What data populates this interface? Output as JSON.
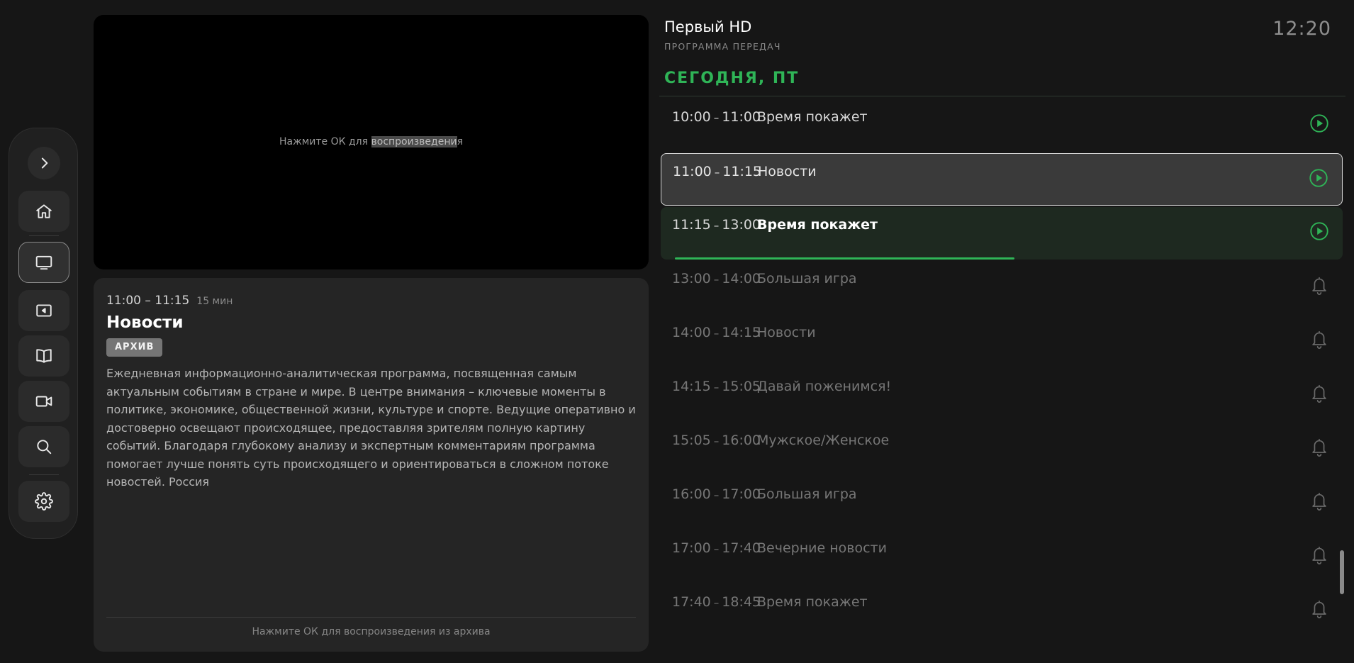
{
  "sidebar": {
    "items": [
      {
        "name": "expand",
        "icon": "chevron-right-icon"
      },
      {
        "name": "home",
        "icon": "home-icon"
      },
      {
        "name": "tv",
        "icon": "tv-icon",
        "active": true
      },
      {
        "name": "archive",
        "icon": "video-player-icon"
      },
      {
        "name": "library",
        "icon": "book-icon"
      },
      {
        "name": "camera",
        "icon": "video-camera-icon"
      },
      {
        "name": "search",
        "icon": "search-icon"
      },
      {
        "name": "settings",
        "icon": "gear-icon"
      }
    ]
  },
  "player": {
    "hint_prefix": "Нажмите ОК для ",
    "hint_highlight": "воспроизведени",
    "hint_suffix": "я"
  },
  "info": {
    "time": "11:00 – 11:15",
    "duration": "15 мин",
    "title": "Новости",
    "badge": "АРХИВ",
    "description": "Ежедневная информационно-аналитическая программа, посвященная самым актуальным событиям в стране и мире. В центре внимания – ключевые моменты в политике, экономике, общественной жизни, культуре и спорте. Ведущие оперативно и достоверно освещают происходящее, предоставляя зрителям полную картину событий. Благодаря глубокому анализу и экспертным комментариям программа помогает лучше понять суть происходящего и ориентироваться в сложном потоке новостей. Россия",
    "footer_hint": "Нажмите ОК для воспроизведения из архива"
  },
  "header": {
    "channel": "Первый HD",
    "subtitle": "ПРОГРАММА ПЕРЕДАЧ",
    "clock": "12:20",
    "day": "СЕГОДНЯ, ПТ"
  },
  "schedule": [
    {
      "start": "10:00",
      "end": "11:00",
      "title": "Время покажет",
      "state": "past",
      "action": "play-icon"
    },
    {
      "start": "11:00",
      "end": "11:15",
      "title": "Новости",
      "state": "selected",
      "action": "play-icon"
    },
    {
      "start": "11:15",
      "end": "13:00",
      "title": "Время покажет",
      "state": "current",
      "action": "play-icon",
      "progress": 0.52
    },
    {
      "start": "13:00",
      "end": "14:00",
      "title": "Большая игра",
      "state": "future",
      "action": "bell-icon"
    },
    {
      "start": "14:00",
      "end": "14:15",
      "title": "Новости",
      "state": "future",
      "action": "bell-icon"
    },
    {
      "start": "14:15",
      "end": "15:05",
      "title": "Давай поженимся!",
      "state": "future",
      "action": "bell-icon"
    },
    {
      "start": "15:05",
      "end": "16:00",
      "title": "Мужское/Женское",
      "state": "future",
      "action": "bell-icon"
    },
    {
      "start": "16:00",
      "end": "17:00",
      "title": "Большая игра",
      "state": "future",
      "action": "bell-icon"
    },
    {
      "start": "17:00",
      "end": "17:40",
      "title": "Вечерние новости",
      "state": "future",
      "action": "bell-icon"
    },
    {
      "start": "17:40",
      "end": "18:45",
      "title": "Время покажет",
      "state": "future",
      "action": "bell-icon"
    }
  ],
  "colors": {
    "accent": "#2fb457",
    "background": "#161616",
    "panel": "#252525"
  }
}
